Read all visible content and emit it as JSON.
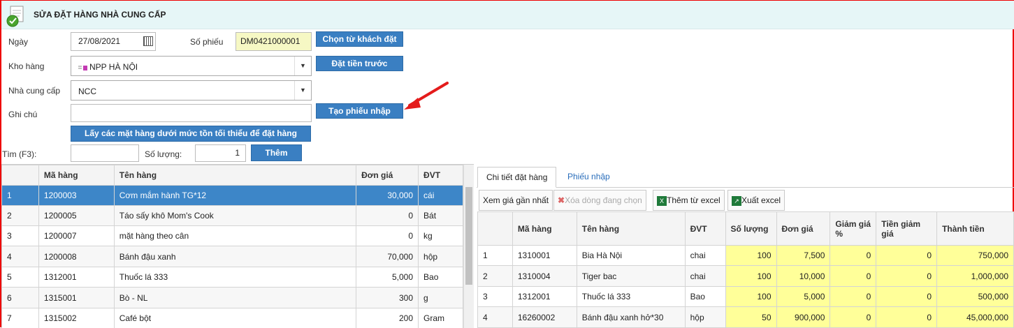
{
  "header": {
    "title": "SỬA ĐẶT HÀNG NHÀ CUNG CẤP"
  },
  "form": {
    "date_label": "Ngày",
    "date_value": "27/08/2021",
    "voucher_label": "Số phiếu",
    "voucher_value": "DM0421000001",
    "warehouse_label": "Kho hàng",
    "warehouse_value": "NPP HÀ NỘI",
    "supplier_label": "Nhà cung cấp",
    "supplier_value": "NCC",
    "note_label": "Ghi chú",
    "note_value": "",
    "btn_choose_customer": "Chọn từ khách đặt",
    "btn_prepay": "Đặt tiền trước",
    "btn_create_receipt": "Tạo phiếu nhập",
    "btn_min_stock": "Lấy các mặt hàng dưới mức tồn tối thiểu để đặt hàng",
    "search_label": "Tìm (F3):",
    "qty_label": "Số lượng:",
    "qty_value": "1",
    "btn_add": "Thêm"
  },
  "product_table": {
    "headers": [
      "",
      "Mã hàng",
      "Tên hàng",
      "Đơn giá",
      "ĐVT"
    ],
    "rows": [
      [
        "1",
        "1200003",
        "Cơm mắm hành TG*12",
        "30,000",
        "cái"
      ],
      [
        "2",
        "1200005",
        "Táo sấy khô Mom's Cook",
        "0",
        "Bát"
      ],
      [
        "3",
        "1200007",
        "mặt hàng theo cân",
        "0",
        "kg"
      ],
      [
        "4",
        "1200008",
        "Bánh đậu xanh",
        "70,000",
        "hộp"
      ],
      [
        "5",
        "1312001",
        "Thuốc lá 333",
        "5,000",
        "Bao"
      ],
      [
        "6",
        "1315001",
        "Bò - NL",
        "300",
        "g"
      ],
      [
        "7",
        "1315002",
        "Café bột",
        "200",
        "Gram"
      ]
    ]
  },
  "tabs": {
    "detail": "Chi tiết đặt hàng",
    "receipt": "Phiếu nhập"
  },
  "toolbar": {
    "recent_price": "Xem giá gần nhất",
    "delete_row": "Xóa dòng đang chọn",
    "add_from_excel": "Thêm từ excel",
    "export_excel": "Xuất excel"
  },
  "detail_table": {
    "headers": [
      "",
      "Mã hàng",
      "Tên hàng",
      "ĐVT",
      "Số lượng",
      "Đơn giá",
      "Giảm giá %",
      "Tiền giảm giá",
      "Thành tiền"
    ],
    "rows": [
      [
        "1",
        "1310001",
        "Bia Hà Nội",
        "chai",
        "100",
        "7,500",
        "0",
        "0",
        "750,000"
      ],
      [
        "2",
        "1310004",
        "Tiger bac",
        "chai",
        "100",
        "10,000",
        "0",
        "0",
        "1,000,000"
      ],
      [
        "3",
        "1312001",
        "Thuốc lá 333",
        "Bao",
        "100",
        "5,000",
        "0",
        "0",
        "500,000"
      ],
      [
        "4",
        "16260002",
        "Bánh đậu xanh hở*30",
        "hộp",
        "50",
        "900,000",
        "0",
        "0",
        "45,000,000"
      ]
    ]
  },
  "colors": {
    "accent": "#3a7fc2",
    "selected_row": "#3d86c8",
    "editable_cell": "#ffff99",
    "annotation_arrow": "#e41b1b"
  }
}
